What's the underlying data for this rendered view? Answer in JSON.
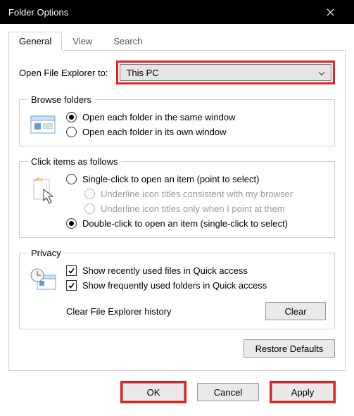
{
  "title": "Folder Options",
  "tabs": {
    "general": "General",
    "view": "View",
    "search": "Search"
  },
  "open_label": "Open File Explorer to:",
  "open_value": "This PC",
  "browse": {
    "legend": "Browse folders",
    "same": "Open each folder in the same window",
    "own": "Open each folder in its own window"
  },
  "click": {
    "legend": "Click items as follows",
    "single": "Single-click to open an item (point to select)",
    "ul_browser": "Underline icon titles consistent with my browser",
    "ul_point": "Underline icon titles only when I point at them",
    "double": "Double-click to open an item (single-click to select)"
  },
  "privacy": {
    "legend": "Privacy",
    "recent": "Show recently used files in Quick access",
    "frequent": "Show frequently used folders in Quick access",
    "clear_label": "Clear File Explorer history",
    "clear_btn": "Clear"
  },
  "restore": "Restore Defaults",
  "buttons": {
    "ok": "OK",
    "cancel": "Cancel",
    "apply": "Apply"
  }
}
